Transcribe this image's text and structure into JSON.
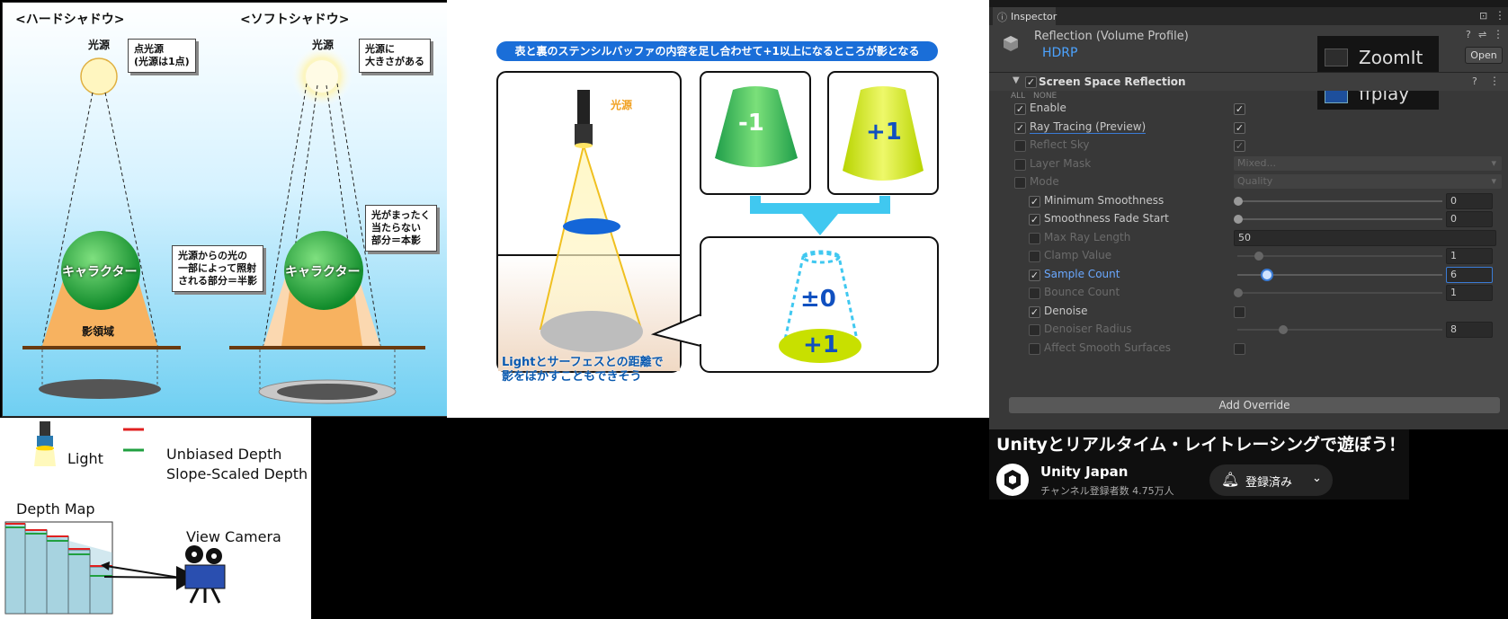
{
  "hard_soft": {
    "hard_title": "<ハードシャドウ>",
    "soft_title": "<ソフトシャドウ>",
    "light_label_1": "光源",
    "light_label_2": "光源",
    "point_light_callout": [
      "点光源",
      "(光源は1点)"
    ],
    "size_callout": [
      "光源に",
      "大きさがある"
    ],
    "character_1": "キャラクター",
    "character_2": "キャラクター",
    "shadow_region": "影領域",
    "penumbra_callout": [
      "光源からの光の",
      "一部によって照射",
      "される部分＝半影"
    ],
    "umbra_callout": [
      "光がまったく",
      "当たらない",
      "部分＝本影"
    ]
  },
  "stencil": {
    "banner": "表と裏のステンシルバッファの内容を足し合わせて+1以上になるところが影となる",
    "light_label": "光源",
    "minus_label": "-1",
    "plus_label": "+1",
    "zero_label": "±0",
    "result_label": "+1",
    "caption": [
      "Lightとサーフェスとの距離で",
      "影をぼかすこともできそう"
    ]
  },
  "depth_map": {
    "light_label": "Light",
    "legend_unbiased": "Unbiased Depth",
    "legend_slope": "Slope-Scaled Depth",
    "map_title": "Depth Map",
    "camera_label": "View Camera",
    "colors": {
      "unbiased": "#e02020",
      "slope": "#20a040"
    }
  },
  "inspector": {
    "tab_label": "Inspector",
    "object_title": "Reflection (Volume Profile)",
    "object_subtitle": "HDRP",
    "open_button": "Open",
    "overlay_items": [
      "ZoomIt",
      "ffplay"
    ],
    "section_title": "Screen Space Reflection",
    "all_label": "ALL",
    "none_label": "NONE",
    "add_override": "Add Override",
    "properties": [
      {
        "label": "Enable",
        "override": true,
        "value_type": "check",
        "checked": true,
        "dim": false
      },
      {
        "label": "Ray Tracing (Preview)",
        "override": true,
        "value_type": "check",
        "checked": true,
        "dim": false
      },
      {
        "label": "Reflect Sky",
        "override": false,
        "value_type": "check",
        "checked": true,
        "dim": true
      },
      {
        "label": "Layer Mask",
        "override": false,
        "value_type": "dropdown",
        "value": "Mixed...",
        "dim": true
      },
      {
        "label": "Mode",
        "override": false,
        "value_type": "dropdown",
        "value": "Quality",
        "dim": true
      },
      {
        "label": "Minimum Smoothness",
        "override": true,
        "value_type": "slider",
        "value": "0",
        "fraction": 0.0,
        "dim": false
      },
      {
        "label": "Smoothness Fade Start",
        "override": true,
        "value_type": "slider",
        "value": "0",
        "fraction": 0.0,
        "dim": false
      },
      {
        "label": "Max Ray Length",
        "override": false,
        "value_type": "field",
        "value": "50",
        "dim": true
      },
      {
        "label": "Clamp Value",
        "override": false,
        "value_type": "slider",
        "value": "1",
        "fraction": 0.1,
        "dim": true
      },
      {
        "label": "Sample Count",
        "override": true,
        "value_type": "slider",
        "value": "6",
        "fraction": 0.14,
        "dim": false,
        "active": true
      },
      {
        "label": "Bounce Count",
        "override": false,
        "value_type": "slider",
        "value": "1",
        "fraction": 0.0,
        "dim": true
      },
      {
        "label": "Denoise",
        "override": true,
        "value_type": "check",
        "checked": false,
        "dim": false
      },
      {
        "label": "Denoiser Radius",
        "override": false,
        "value_type": "slider",
        "value": "8",
        "fraction": 0.22,
        "dim": true,
        "indent": true
      },
      {
        "label": "Affect Smooth Surfaces",
        "override": false,
        "value_type": "check",
        "checked": false,
        "dim": true,
        "indent": true
      }
    ]
  },
  "video": {
    "title": "Unityとリアルタイム・レイトレーシングで遊ぼう！",
    "channel": "Unity Japan",
    "subscribers": "チャンネル登録者数 4.75万人",
    "subscribe_label": "登録済み"
  }
}
